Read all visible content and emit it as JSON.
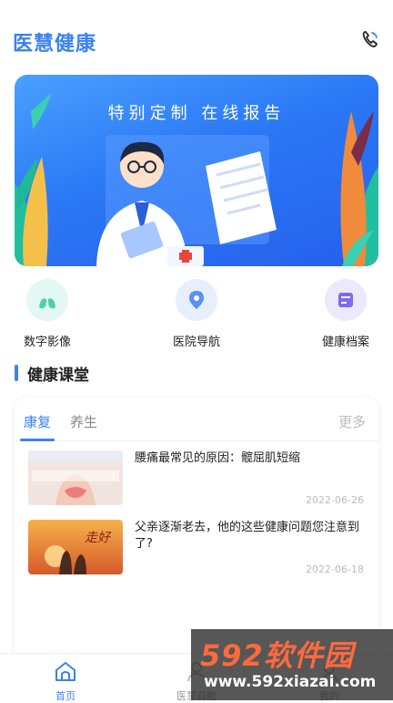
{
  "header": {
    "title": "医慧健康",
    "phone_icon": "phone-icon"
  },
  "banner": {
    "title": "特别定制  在线报告"
  },
  "quick_actions": [
    {
      "label": "数字影像",
      "icon": "lungs-icon",
      "bg": "#e3f7f3",
      "color": "#4ccfb0"
    },
    {
      "label": "医院导航",
      "icon": "location-pin-icon",
      "bg": "#e7efff",
      "color": "#5b8ff7"
    },
    {
      "label": "健康档案",
      "icon": "records-icon",
      "bg": "#ece9fb",
      "color": "#7b6cf0"
    }
  ],
  "section": {
    "title": "健康课堂"
  },
  "course_card": {
    "tabs": [
      "康复",
      "养生"
    ],
    "active_tab": "康复",
    "more_label": "更多",
    "articles": [
      {
        "title": "腰痛最常见的原因：髋屈肌短缩",
        "date": "2022-06-26",
        "thumb_caption": "腰痛最常见的原因：髋屈肌短缩"
      },
      {
        "title": "父亲逐渐老去，他的这些健康问题您注意到了?",
        "date": "2022-06-18",
        "thumb_caption": "走好"
      }
    ]
  },
  "tabbar": {
    "items": [
      {
        "label": "首页",
        "icon": "home-icon",
        "active": true
      },
      {
        "label": "医慧自助",
        "icon": "user-icon",
        "active": false
      },
      {
        "label": "我的",
        "icon": "profile-icon",
        "active": false
      }
    ]
  },
  "watermark": {
    "brand": "592软件园",
    "url": "www.592xiazai.com"
  },
  "colors": {
    "accent": "#3b82f0",
    "banner_blue": "#2a78f5",
    "text_muted": "#bbbbbb"
  }
}
